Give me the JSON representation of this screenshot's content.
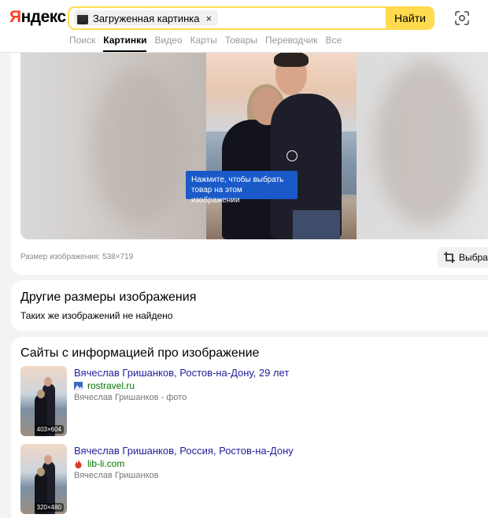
{
  "header": {
    "logo": "Яндекс",
    "search_chip_label": "Загруженная картинка",
    "search_chip_close": "×",
    "search_button": "Найти"
  },
  "tabs": [
    {
      "label": "Поиск",
      "active": false
    },
    {
      "label": "Картинки",
      "active": true
    },
    {
      "label": "Видео",
      "active": false
    },
    {
      "label": "Карты",
      "active": false
    },
    {
      "label": "Товары",
      "active": false
    },
    {
      "label": "Переводчик",
      "active": false
    },
    {
      "label": "Все",
      "active": false
    }
  ],
  "viewer": {
    "tooltip": "Нажмите, чтобы выбрать товар на этом изображении",
    "image_size": "Размер изображения: 538×719",
    "select_button": "Выбрат"
  },
  "other_sizes": {
    "title": "Другие размеры изображения",
    "message": "Таких же изображений не найдено"
  },
  "sites": {
    "title": "Сайты с информацией про изображение",
    "items": [
      {
        "title": "Вячеслав Гришанков, Ростов-на-Дону, 29 лет",
        "domain": "rostravel.ru",
        "description": "Вячеслав Гришанков - фото",
        "dims": "403×604"
      },
      {
        "title": "Вячеслав Гришанков, Россия, Ростов-на-Дону",
        "domain": "lib-li.com",
        "description": "Вячеслав Гришанков",
        "dims": "320×480"
      }
    ]
  },
  "colors": {
    "accent": "#ffdb4d",
    "logo_red": "#fc3f1d",
    "tooltip": "#1a5ac8",
    "link": "#221d9a",
    "domain": "#007700"
  }
}
